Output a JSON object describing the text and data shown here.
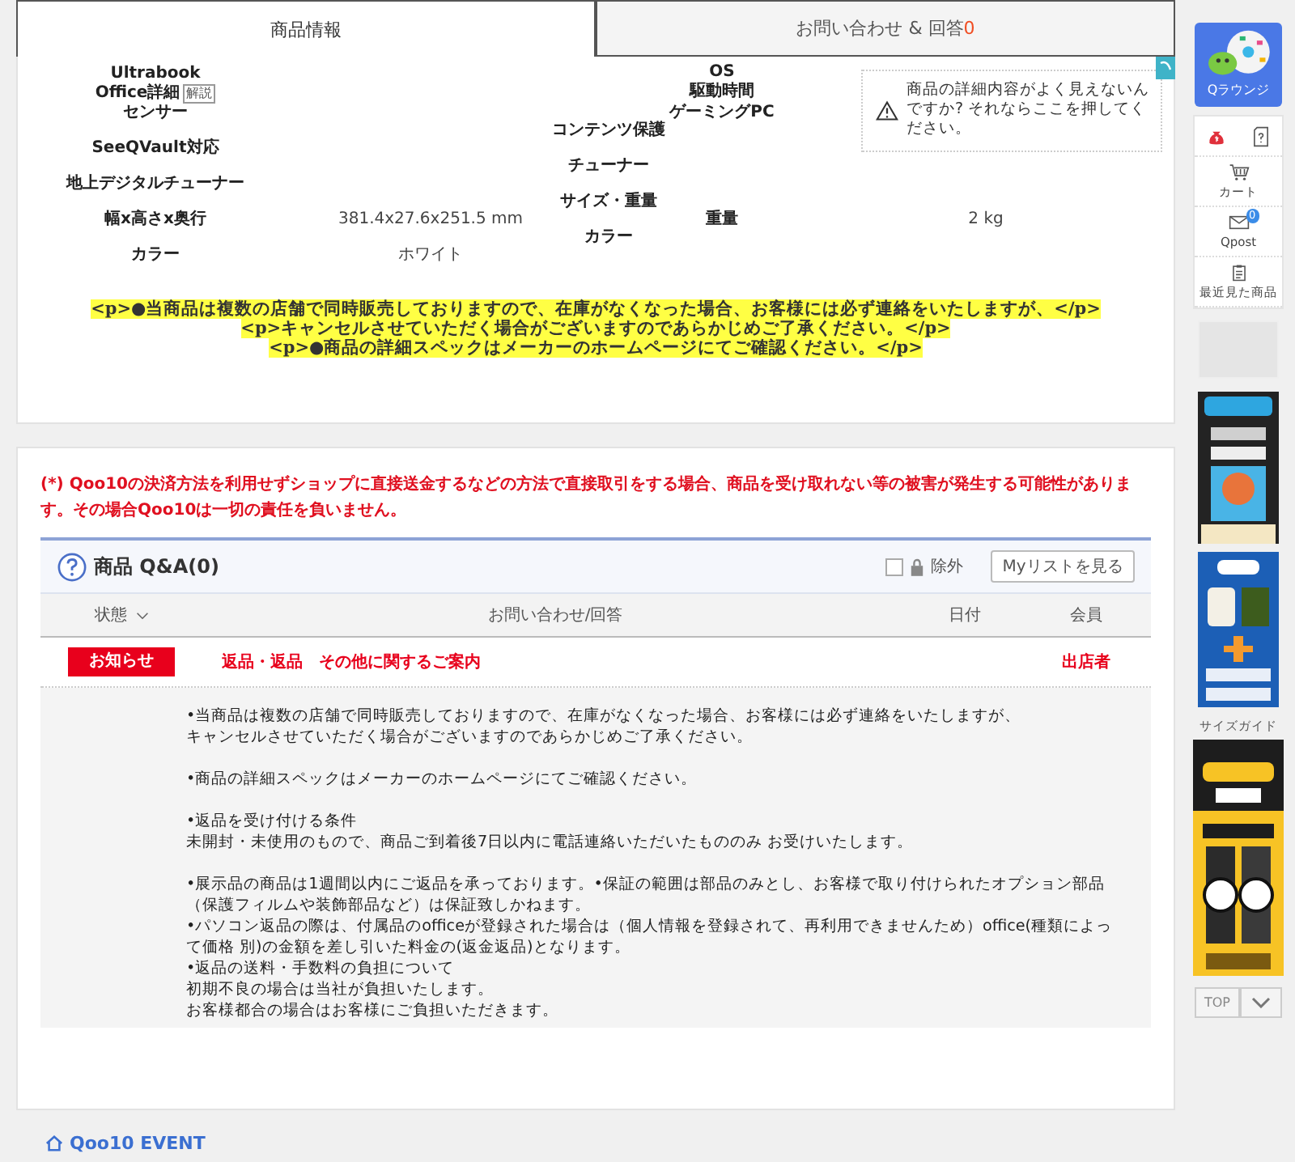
{
  "tabs": [
    {
      "label": "商品情報",
      "selected": true
    },
    {
      "label": "お問い合わせ & 回答",
      "count": "0",
      "selected": false
    }
  ],
  "specs": [
    [
      {
        "kind": "label",
        "text": "Ultrabook"
      },
      {
        "kind": "label",
        "text": "Office詳細",
        "badge": "解説"
      },
      {
        "kind": "label",
        "text": "センサー"
      },
      {
        "kind": "label",
        "text": "SeeQVault対応"
      },
      {
        "kind": "label",
        "text": "地上デジタルチューナー"
      },
      {
        "kind": "label",
        "text": "幅x高さx奥行"
      },
      {
        "kind": "label",
        "text": "カラー"
      }
    ],
    [
      {
        "kind": "value",
        "text": "381.4x27.6x251.5 mm"
      },
      {
        "kind": "value",
        "text": "ホワイト"
      }
    ],
    [
      {
        "kind": "label",
        "text": "コンテンツ保護"
      },
      {
        "kind": "label",
        "text": "チューナー"
      },
      {
        "kind": "label",
        "text": "サイズ・重量"
      },
      {
        "kind": "label",
        "text": "カラー"
      }
    ],
    [
      {
        "kind": "label",
        "text": "OS"
      },
      {
        "kind": "label",
        "text": "駆動時間"
      },
      {
        "kind": "label",
        "text": "ゲーミングPC"
      },
      {
        "kind": "label",
        "text": "重量"
      }
    ],
    [
      {
        "kind": "value",
        "text": "2 kg"
      }
    ]
  ],
  "spec_tip": "商品の詳細内容がよく見えないんですか? それならここを押してください。",
  "highlighted_lines": [
    "<p>●当商品は複数の店舗で同時販売しておりますので、在庫がなくなった場合、お客様には必ず連絡をいたしますが、</p>",
    "<p>キャンセルさせていただく場合がございますのであらかじめご了承ください。</p>",
    "<p>●商品の詳細スペックはメーカーのホームページにてご確認ください。</p>"
  ],
  "warning": "(*) Qoo10の決済方法を利用せずショップに直接送金するなどの方法で直接取引をする場合、商品を受け取れない等の被害が発生する可能性があります。その場合Qoo10は一切の責任を負いません。",
  "qa": {
    "title": "商品 Q&A(0)",
    "exclude": {
      "label": "除外",
      "checked": false
    },
    "mylist_button": "Myリストを見る",
    "columns": [
      "状態",
      "お問い合わせ/回答",
      "日付",
      "会員"
    ],
    "notice": {
      "badge": "お知らせ",
      "title": "返品・返品　その他に関するご案内",
      "author": "出店者"
    },
    "body": [
      [
        "•当商品は複数の店舗で同時販売しておりますので、在庫がなくなった場合、お客様には必ず連絡をいたしますが、",
        "キャンセルさせていただく場合がございますのであらかじめご了承ください。"
      ],
      [
        "•商品の詳細スペックはメーカーのホームページにてご確認ください。"
      ],
      [
        "•返品を受け付ける条件",
        "未開封・未使用のもので、商品ご到着後7日以内に電話連絡いただいたもののみ お受けいたします。"
      ],
      [
        "•展示品の商品は1週間以内にご返品を承っております。•保証の範囲は部品のみとし、お客様で取り付けられたオプション部品（保護フィルムや装飾部品など）は保証致しかねます。",
        "•パソコン返品の際は、付属品のofficeが登録された場合は（個人情報を登録されて、再利用できませんため）office(種類によって価格 別)の金額を差し引いた料金の(返金返品)となります。",
        "•返品の送料・手数料の負担について",
        "初期不良の場合は当社が負担いたします。",
        "お客様都合の場合はお客様にご負担いただきます。"
      ]
    ]
  },
  "event_link": "Qoo10 EVENT",
  "sidebar": {
    "lounge": "Qラウンジ",
    "cart": "カート",
    "qpost": {
      "label": "Qpost",
      "count": "0"
    },
    "recent": "最近見た商品",
    "size_guide": "サイズガイド",
    "top": "TOP"
  }
}
